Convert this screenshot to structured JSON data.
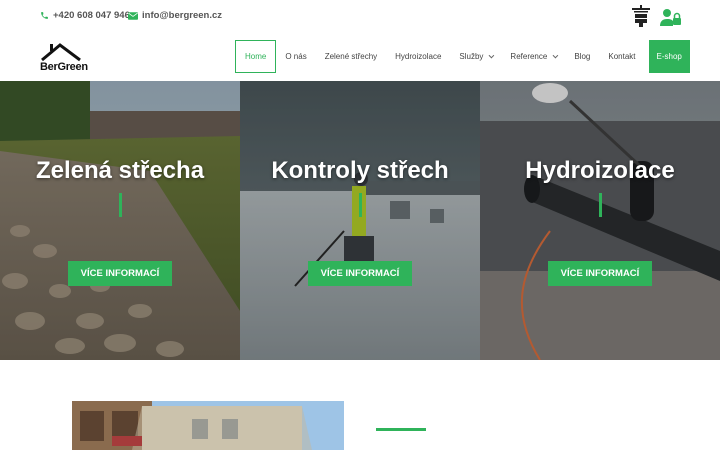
{
  "topbar": {
    "phone": "+420 608 047 946",
    "email": "info@bergreen.cz",
    "icons": [
      "phone-icon",
      "mail-icon",
      "crane-icon",
      "user-lock-icon"
    ]
  },
  "brand": {
    "name": "BerGreen"
  },
  "nav": {
    "items": [
      {
        "label": "Home",
        "active": true
      },
      {
        "label": "O nás"
      },
      {
        "label": "Zelené střechy"
      },
      {
        "label": "Hydroizolace"
      },
      {
        "label": "Služby",
        "dropdown": true
      },
      {
        "label": "Reference",
        "dropdown": true
      },
      {
        "label": "Blog"
      },
      {
        "label": "Kontakt"
      },
      {
        "label": "E-shop",
        "highlight": true
      }
    ]
  },
  "hero": {
    "panels": [
      {
        "title": "Zelená střecha",
        "button": "VÍCE INFORMACÍ"
      },
      {
        "title": "Kontroly střech",
        "button": "VÍCE INFORMACÍ"
      },
      {
        "title": "Hydroizolace",
        "button": "VÍCE INFORMACÍ"
      }
    ]
  },
  "colors": {
    "accent": "#2fb35a",
    "text": "#444444"
  }
}
